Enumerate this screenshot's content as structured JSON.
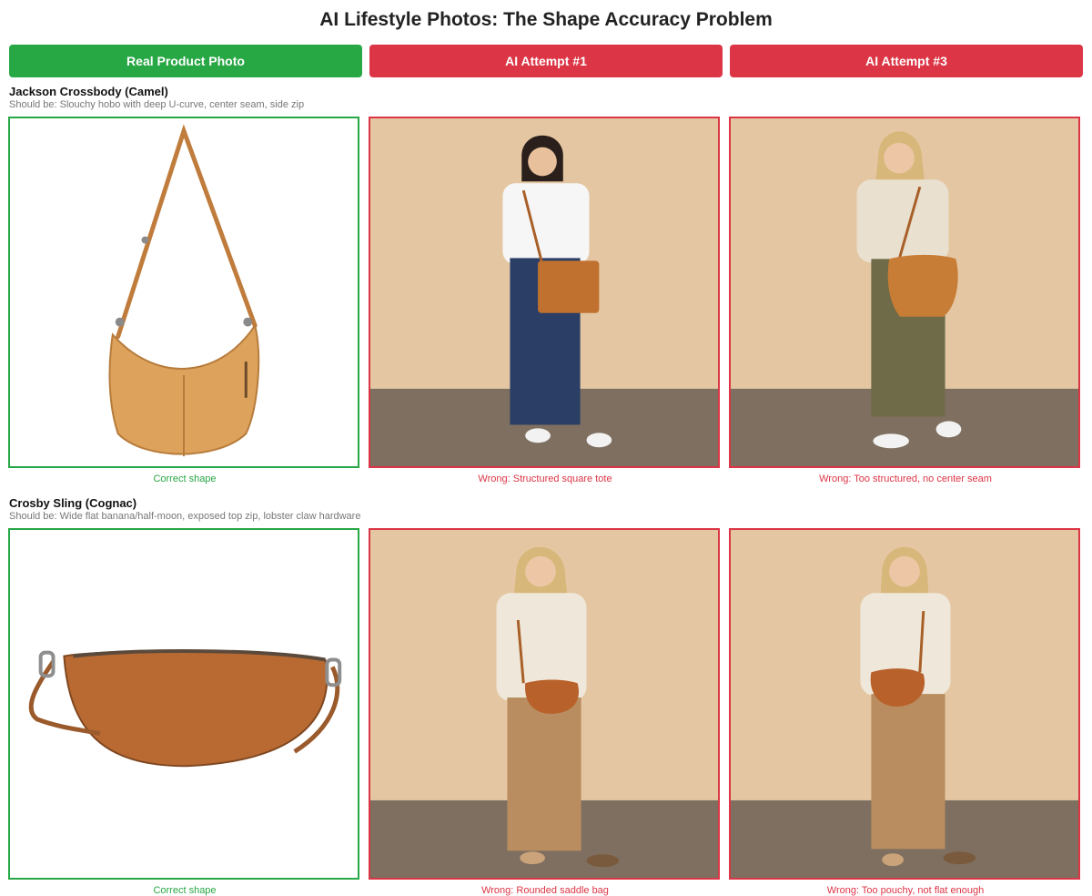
{
  "title": "AI Lifestyle Photos: The Shape Accuracy Problem",
  "columns": {
    "real": "Real Product Photo",
    "ai1": "AI Attempt #1",
    "ai3": "AI Attempt #3"
  },
  "products": [
    {
      "name": "Jackson Crossbody (Camel)",
      "description": "Should be: Slouchy hobo with deep U-curve, center seam, side zip",
      "real_caption": "Correct shape",
      "ai1_caption": "Wrong: Structured square tote",
      "ai3_caption": "Wrong: Too structured, no center seam"
    },
    {
      "name": "Crosby Sling (Cognac)",
      "description": "Should be: Wide flat banana/half-moon, exposed top zip, lobster claw hardware",
      "real_caption": "Correct shape",
      "ai1_caption": "Wrong: Rounded saddle bag",
      "ai3_caption": "Wrong: Too pouchy, not flat enough"
    }
  ],
  "colors": {
    "correct": "#28a745",
    "wrong": "#dc3545",
    "backdrop": "#e2c6a2"
  }
}
